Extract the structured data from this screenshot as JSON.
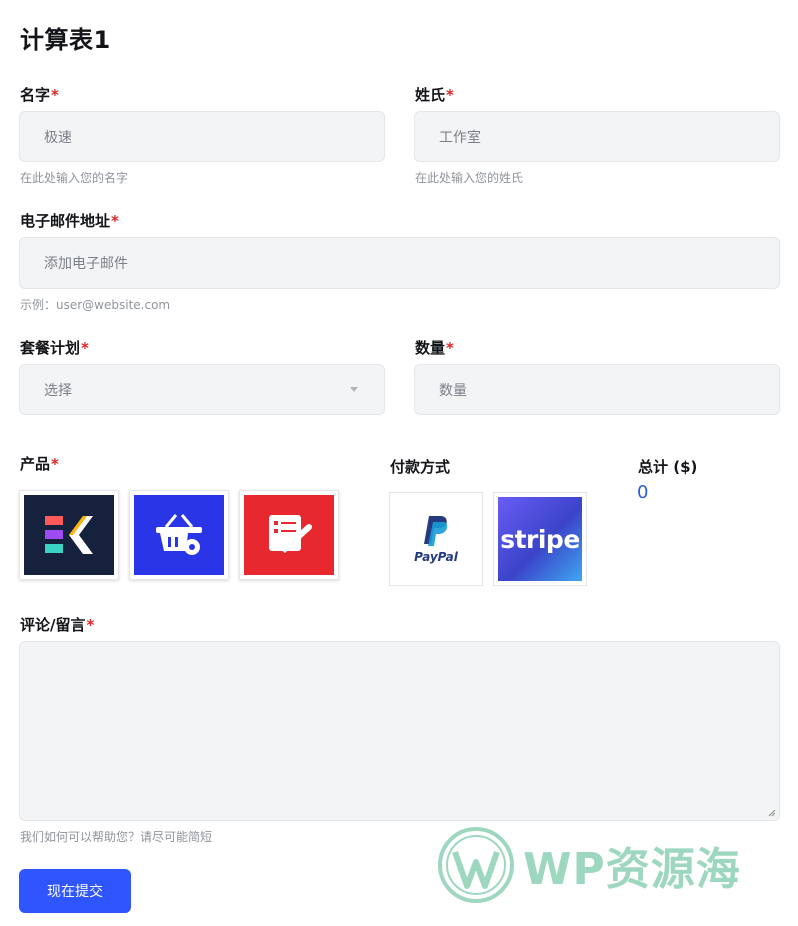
{
  "form": {
    "title": "计算表1",
    "required_mark": "*",
    "first_name": {
      "label": "名字",
      "value": "极速",
      "hint": "在此处输入您的名字"
    },
    "last_name": {
      "label": "姓氏",
      "value": "工作室",
      "hint": "在此处输入您的姓氏"
    },
    "email": {
      "label": "电子邮件地址",
      "placeholder": "添加电子邮件",
      "hint": "示例：user@website.com"
    },
    "plan": {
      "label": "套餐计划",
      "selected": "选择"
    },
    "quantity": {
      "label": "数量",
      "placeholder": "数量"
    },
    "products": {
      "label": "产品",
      "items": [
        {
          "name": "elementskit-logo",
          "bg": "#16213e"
        },
        {
          "name": "basket-gear-logo",
          "bg": "#2b35e8"
        },
        {
          "name": "checklist-logo",
          "bg": "#e8282f"
        }
      ]
    },
    "payment": {
      "label": "付款方式",
      "paypal": "PayPal",
      "stripe": "stripe"
    },
    "total": {
      "label": "总计 ($)",
      "value": "0"
    },
    "comment": {
      "label": "评论/留言",
      "hint": "我们如何可以帮助您？请尽可能简短"
    },
    "submit_label": "现在提交"
  },
  "watermark": {
    "text": "WP资源海"
  },
  "colors": {
    "accent": "#2f55ff",
    "required": "#e02424",
    "field_bg": "#f3f4f6",
    "total": "#2b5fd9"
  }
}
